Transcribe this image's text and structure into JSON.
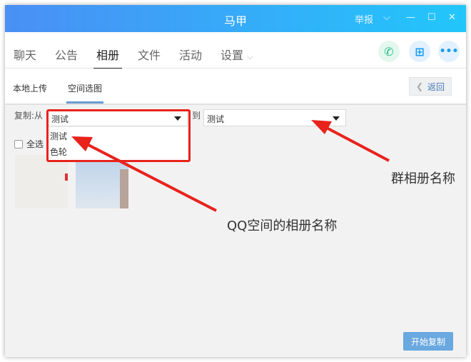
{
  "window": {
    "title": "马甲",
    "report": "举报"
  },
  "tabs": [
    "聊天",
    "公告",
    "相册",
    "文件",
    "活动",
    "设置"
  ],
  "active_tab": "相册",
  "subtabs": [
    "本地上传",
    "空间选图"
  ],
  "back_label": "返回",
  "copy_from_label": "复制:从",
  "from_value": "测试",
  "from_options": [
    "测试",
    "色轮"
  ],
  "to_label": "到",
  "to_value": "测试",
  "select_all": "全选",
  "start_copy": "开始复制",
  "annotations": {
    "qzone": "QQ空间的相册名称",
    "group": "群相册名称"
  },
  "colors": {
    "accent": "#6aa8e0",
    "annotation": "#e8231c"
  }
}
